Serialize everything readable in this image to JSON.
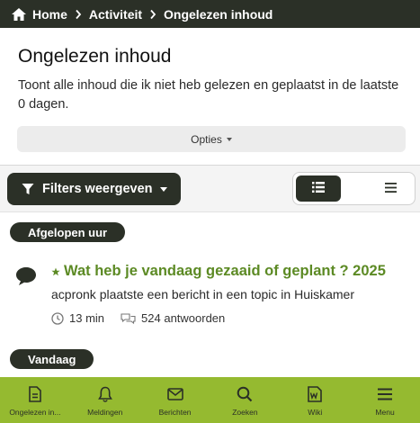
{
  "breadcrumb": {
    "items": [
      "Home",
      "Activiteit",
      "Ongelezen inhoud"
    ]
  },
  "header": {
    "title": "Ongelezen inhoud",
    "description": "Toont alle inhoud die ik niet heb gelezen en geplaatst in de laatste 0 dagen.",
    "options_label": "Opties"
  },
  "toolbar": {
    "filters_label": "Filters weergeven",
    "view_modes": [
      "grid-list-icon",
      "list-icon"
    ],
    "active_view": "grid-list-icon"
  },
  "sections": [
    {
      "label": "Afgelopen uur",
      "topics": [
        {
          "title": "Wat heb je vandaag gezaaid of geplant ? 2025",
          "author": "acpronk",
          "action_text": "plaatste een bericht in een topic in",
          "forum": "Huiskamer",
          "time": "13 min",
          "replies": "524 antwoorden"
        }
      ]
    },
    {
      "label": "Vandaag",
      "topics": []
    }
  ],
  "bottom_nav": [
    {
      "label": "Ongelezen in...",
      "icon": "document-icon"
    },
    {
      "label": "Meldingen",
      "icon": "bell-icon"
    },
    {
      "label": "Berichten",
      "icon": "envelope-icon"
    },
    {
      "label": "Zoeken",
      "icon": "search-icon"
    },
    {
      "label": "Wiki",
      "icon": "wiki-icon"
    },
    {
      "label": "Menu",
      "icon": "menu-icon"
    }
  ],
  "colors": {
    "dark": "#2b3027",
    "accent_green": "#95ba30",
    "title_green": "#5c8a24"
  }
}
